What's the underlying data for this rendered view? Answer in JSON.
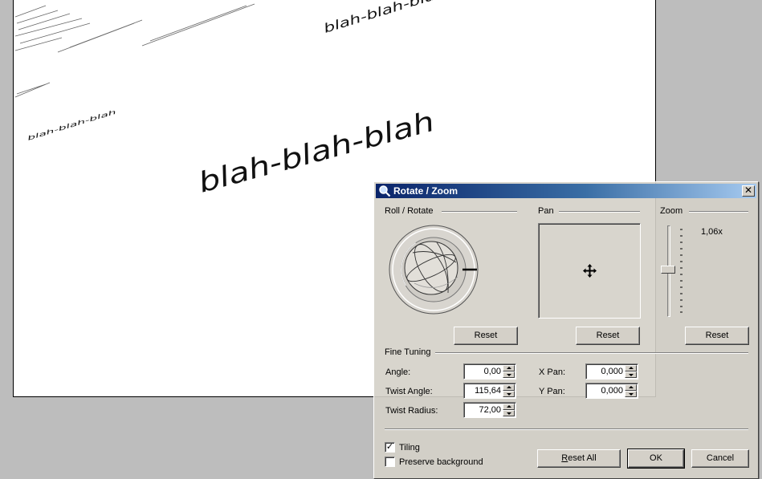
{
  "canvas": {
    "texts": [
      {
        "text": "blah-blah-blah"
      },
      {
        "text": "blah-blah-blah"
      },
      {
        "text": "blah-blah-blah"
      }
    ]
  },
  "dialog": {
    "title": "Rotate / Zoom",
    "title_icon": "magnifier-icon",
    "close_glyph": "✕",
    "groups": {
      "roll_rotate": "Roll / Rotate",
      "pan": "Pan",
      "zoom": "Zoom",
      "fine_tuning": "Fine Tuning"
    },
    "zoom_value": "1,06x",
    "zoom_level": 1.06,
    "reset_label": "Reset",
    "fields": {
      "angle": {
        "label": "Angle:",
        "value": "0,00"
      },
      "twist_angle": {
        "label": "Twist Angle:",
        "value": "115,64"
      },
      "twist_radius": {
        "label": "Twist Radius:",
        "value": "72,00"
      },
      "x_pan": {
        "label": "X Pan:",
        "value": "0,000"
      },
      "y_pan": {
        "label": "Y Pan:",
        "value": "0,000"
      }
    },
    "tiling": {
      "label": "Tiling",
      "checked": true,
      "mark": "✓"
    },
    "preserve_background": {
      "label": "Preserve background",
      "checked": false
    },
    "buttons": {
      "reset_all_key": "R",
      "reset_all_rest": "eset All",
      "ok": "OK",
      "cancel": "Cancel"
    }
  }
}
